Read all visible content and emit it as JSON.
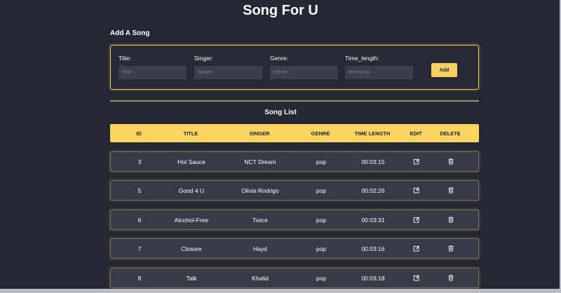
{
  "header": {
    "title": "Song For U"
  },
  "add_form": {
    "heading": "Add A Song",
    "fields": [
      {
        "label": "Title:",
        "placeholder": "Title"
      },
      {
        "label": "Singer:",
        "placeholder": "Singer"
      },
      {
        "label": "Genre:",
        "placeholder": "Genre"
      },
      {
        "label": "Time_length:",
        "placeholder": "hh:mm:ss"
      }
    ],
    "add_label": "Add"
  },
  "song_list": {
    "title": "Song List",
    "columns": [
      "ID",
      "TITLE",
      "SINGER",
      "GENRE",
      "TIME LENGTH",
      "EDIT",
      "DELETE"
    ],
    "rows": [
      {
        "id": "3",
        "title": "Hot Sauce",
        "singer": "NCT Dream",
        "genre": "pop",
        "time": "00:03:15"
      },
      {
        "id": "5",
        "title": "Good 4 U",
        "singer": "Olivia Rodrigo",
        "genre": "pop",
        "time": "00:02:26"
      },
      {
        "id": "6",
        "title": "Alcohol-Free",
        "singer": "Twice",
        "genre": "pop",
        "time": "00:03:31"
      },
      {
        "id": "7",
        "title": "Closure",
        "singer": "Hayd",
        "genre": "pop",
        "time": "00:03:16"
      },
      {
        "id": "8",
        "title": "Talk",
        "singer": "Khalid",
        "genre": "pop",
        "time": "00:03:18"
      }
    ]
  },
  "icons": {
    "edit": "edit-icon",
    "delete": "trash-icon"
  },
  "colors": {
    "accent": "#fdd462",
    "background": "#242832",
    "row": "#373b47"
  }
}
